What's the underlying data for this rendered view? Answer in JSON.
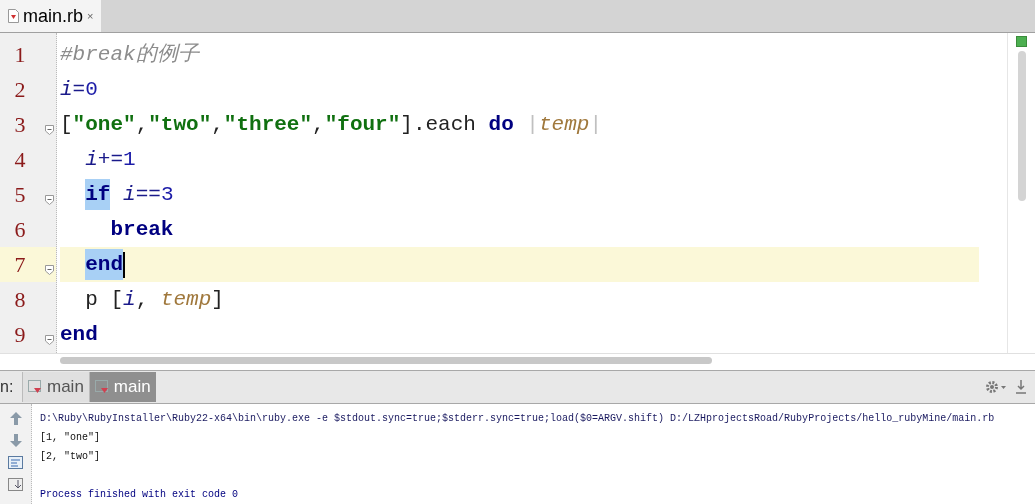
{
  "editor_tabs": [
    {
      "label": "main.rb",
      "close": "×",
      "selected": true
    }
  ],
  "code_lines": [
    {
      "number": "1",
      "fold": false,
      "current": false,
      "tokens": [
        {
          "kind": "comment",
          "text": "#break的例子",
          "highlighted": false
        }
      ]
    },
    {
      "number": "2",
      "fold": false,
      "current": false,
      "tokens": [
        {
          "kind": "var",
          "text": "i",
          "highlighted": false
        },
        {
          "kind": "op",
          "text": "=",
          "highlighted": false
        },
        {
          "kind": "number",
          "text": "0",
          "highlighted": false
        }
      ]
    },
    {
      "number": "3",
      "fold": true,
      "current": false,
      "tokens": [
        {
          "kind": "plain",
          "text": "[",
          "highlighted": false
        },
        {
          "kind": "string",
          "text": "\"one\"",
          "highlighted": false
        },
        {
          "kind": "plain",
          "text": ",",
          "highlighted": false
        },
        {
          "kind": "string",
          "text": "\"two\"",
          "highlighted": false
        },
        {
          "kind": "plain",
          "text": ",",
          "highlighted": false
        },
        {
          "kind": "string",
          "text": "\"three\"",
          "highlighted": false
        },
        {
          "kind": "plain",
          "text": ",",
          "highlighted": false
        },
        {
          "kind": "string",
          "text": "\"four\"",
          "highlighted": false
        },
        {
          "kind": "plain",
          "text": "].each ",
          "highlighted": false
        },
        {
          "kind": "keyword",
          "text": "do",
          "highlighted": false
        },
        {
          "kind": "pipe",
          "text": " |",
          "highlighted": false
        },
        {
          "kind": "param",
          "text": "temp",
          "highlighted": false
        },
        {
          "kind": "pipe",
          "text": "|",
          "highlighted": false
        }
      ]
    },
    {
      "number": "4",
      "fold": false,
      "current": false,
      "tokens": [
        {
          "kind": "var",
          "text": "  i",
          "highlighted": false
        },
        {
          "kind": "op",
          "text": "+=",
          "highlighted": false
        },
        {
          "kind": "number",
          "text": "1",
          "highlighted": false
        }
      ]
    },
    {
      "number": "5",
      "fold": true,
      "current": false,
      "tokens": [
        {
          "kind": "keyword",
          "text": "  if",
          "highlighted": true
        },
        {
          "kind": "var",
          "text": " i",
          "highlighted": false
        },
        {
          "kind": "op",
          "text": "==",
          "highlighted": false
        },
        {
          "kind": "number",
          "text": "3",
          "highlighted": false
        }
      ]
    },
    {
      "number": "6",
      "fold": false,
      "current": false,
      "tokens": [
        {
          "kind": "keyword",
          "text": "    break",
          "highlighted": false
        }
      ]
    },
    {
      "number": "7",
      "fold": true,
      "current": true,
      "tokens": [
        {
          "kind": "keyword",
          "text": "  end",
          "highlighted": true
        }
      ]
    },
    {
      "number": "8",
      "fold": false,
      "current": false,
      "tokens": [
        {
          "kind": "plain",
          "text": "  p [",
          "highlighted": false
        },
        {
          "kind": "var",
          "text": "i",
          "highlighted": false
        },
        {
          "kind": "plain",
          "text": ", ",
          "highlighted": false
        },
        {
          "kind": "param",
          "text": "temp",
          "highlighted": false
        },
        {
          "kind": "plain",
          "text": "]",
          "highlighted": false
        }
      ]
    },
    {
      "number": "9",
      "fold": true,
      "current": false,
      "tokens": [
        {
          "kind": "keyword",
          "text": "end",
          "highlighted": false
        }
      ]
    }
  ],
  "run_panel": {
    "label": "n:",
    "tabs": [
      {
        "label": "main",
        "selected": false
      },
      {
        "label": "main",
        "selected": true
      }
    ]
  },
  "console_lines": [
    {
      "kind": "command",
      "text": "D:\\Ruby\\RubyInstaller\\Ruby22-x64\\bin\\ruby.exe -e $stdout.sync=true;$stderr.sync=true;load($0=ARGV.shift) D:/LZHprojectsRoad/RubyProjects/hello_rubyMine/main.rb"
    },
    {
      "kind": "output",
      "text": "[1, \"one\"]"
    },
    {
      "kind": "output",
      "text": "[2, \"two\"]"
    },
    {
      "kind": "blank"
    },
    {
      "kind": "status",
      "text": "Process finished with exit code 0"
    }
  ]
}
